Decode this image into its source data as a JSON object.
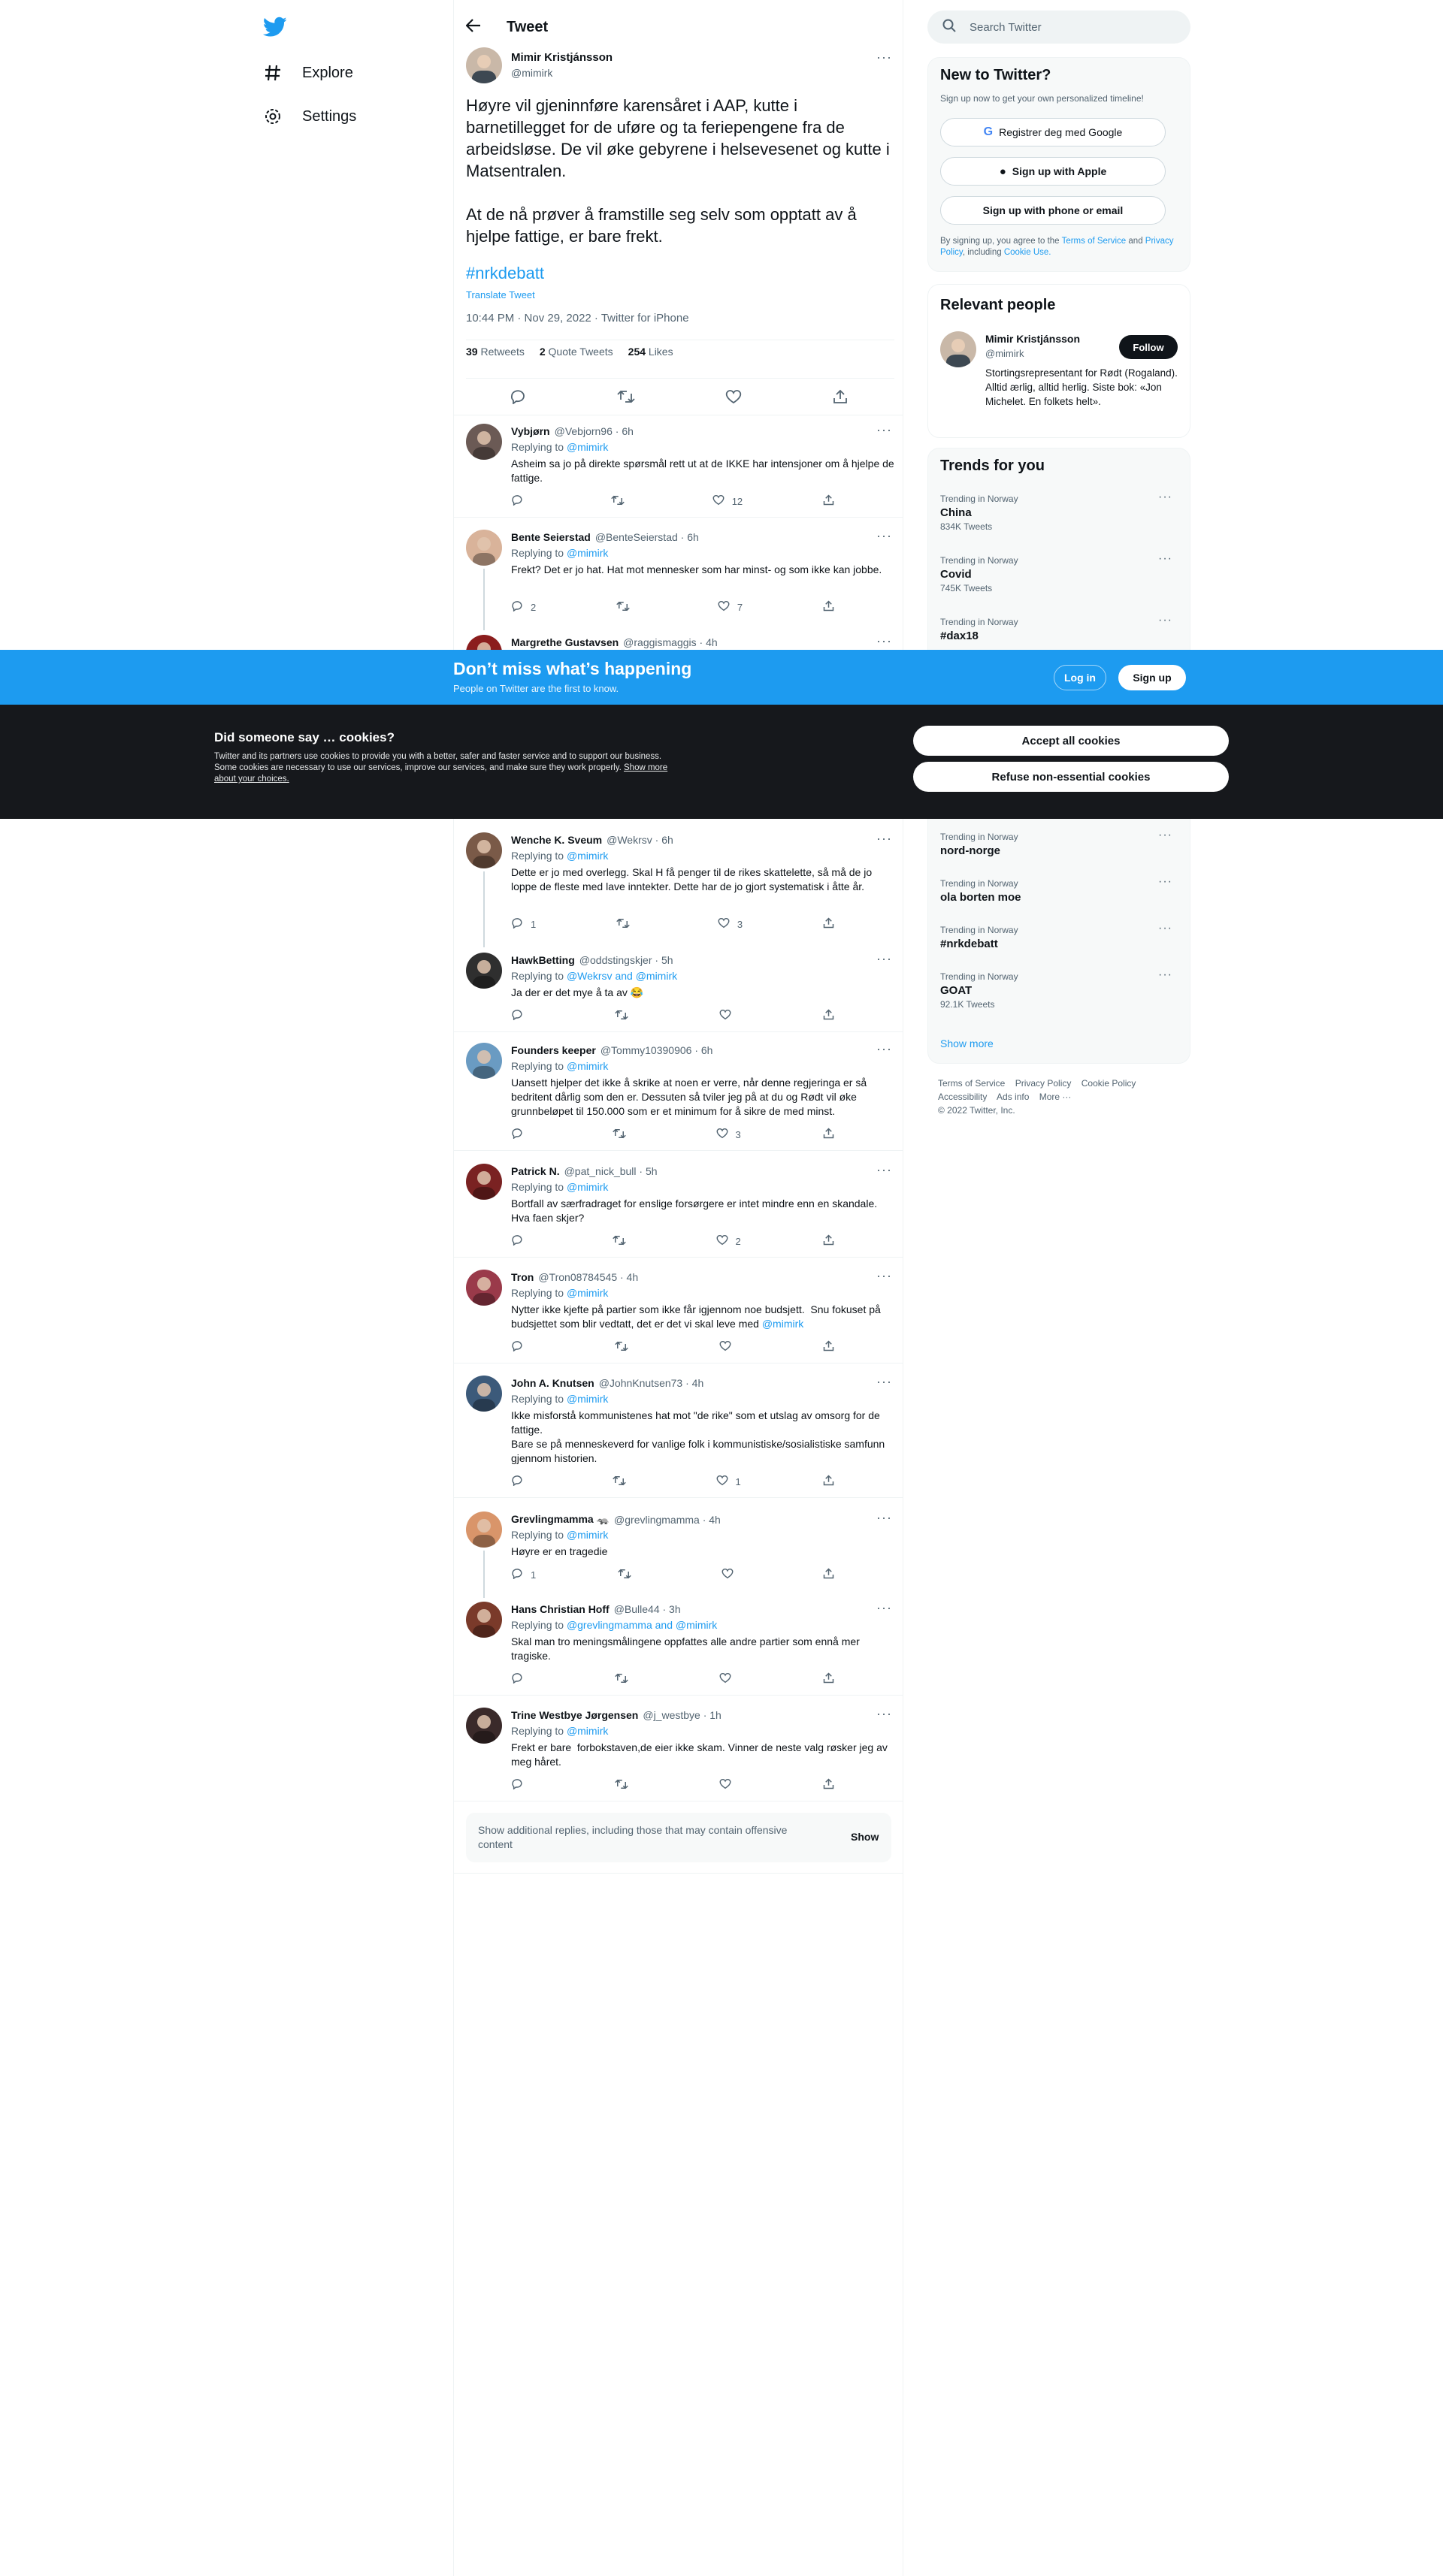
{
  "nav": {
    "items": [
      {
        "label": "Explore",
        "icon": "hashtag-icon"
      },
      {
        "label": "Settings",
        "icon": "gear-icon"
      }
    ]
  },
  "header": {
    "title": "Tweet"
  },
  "tweet": {
    "author_name": "Mimir Kristjánsson",
    "author_handle": "@mimirk",
    "text": "Høyre vil gjeninnføre karensåret i AAP, kutte i barnetillegget for de uføre og ta feriepengene fra de arbeidsløse. De vil øke gebyrene i helsevesenet og kutte i Matsentralen.\n\nAt de nå prøver å framstille seg selv som opptatt av å hjelpe fattige, er bare frekt.",
    "hashtag": "#nrkdebatt",
    "translate": "Translate Tweet",
    "meta": "10:44 PM · Nov 29, 2022 · Twitter for iPhone",
    "retweets": "39",
    "retweets_label": "Retweets",
    "quotes": "2",
    "quotes_label": "Quote Tweets",
    "likes": "254",
    "likes_label": "Likes"
  },
  "replies": [
    {
      "name": "Vybjørn",
      "handle": "@Vebjorn96 · 6h",
      "replying_label": "Replying to",
      "replying_to": "@mimirk",
      "text": "Asheim sa jo på direkte spørsmål rett ut at de IKKE har intensjoner om å hjelpe de fattige.",
      "replies": "",
      "retweets": "",
      "likes": "12"
    },
    {
      "name": "Bente Seierstad",
      "handle": "@BenteSeierstad · 6h",
      "replying_label": "Replying to",
      "replying_to": "@mimirk",
      "text": "Frekt? Det er jo hat. Hat mot mennesker som har minst- og som ikke kan jobbe.",
      "replies": "2",
      "retweets": "",
      "likes": "7"
    },
    {
      "name": "Margrethe Gustavsen",
      "handle": "@raggismaggis · 4h"
    },
    {
      "name": "Wenche K. Sveum",
      "handle": "@Wekrsv · 6h",
      "replying_label": "Replying to",
      "replying_to": "@mimirk",
      "text": "Dette er jo med overlegg. Skal H få penger til de rikes skattelette, så må de jo loppe de fleste med lave inntekter. Dette har de jo gjort systematisk i åtte år.",
      "replies": "1",
      "retweets": "",
      "likes": "3"
    },
    {
      "name": "HawkBetting",
      "handle": "@oddstingskjer · 5h",
      "replying_label": "Replying to",
      "replying_to": "@Wekrsv and @mimirk",
      "text": "Ja der er det mye å ta av 😂",
      "replies": "",
      "retweets": "",
      "likes": ""
    },
    {
      "name": "Founders keeper",
      "handle": "@Tommy10390906 · 6h",
      "replying_label": "Replying to",
      "replying_to": "@mimirk",
      "text": "Uansett hjelper det ikke å skrike at noen er verre, når denne regjeringa er så bedritent dårlig som den er. Dessuten så tviler jeg på at du og Rødt vil øke grunnbeløpet til 150.000 som er et minimum for å sikre de med minst.",
      "replies": "",
      "retweets": "",
      "likes": "3"
    },
    {
      "name": "Patrick N.",
      "handle": "@pat_nick_bull · 5h",
      "replying_label": "Replying to",
      "replying_to": "@mimirk",
      "text": "Bortfall av særfradraget for enslige forsørgere er intet mindre enn en skandale. Hva faen skjer?",
      "replies": "",
      "retweets": "",
      "likes": "2"
    },
    {
      "name": "Tron",
      "handle": "@Tron08784545 · 4h",
      "replying_label": "Replying to",
      "replying_to": "@mimirk",
      "text": "Nytter ikke kjefte på partier som ikke får igjennom noe budsjett.  Snu fokuset på budsjettet som blir vedtatt, det er det vi skal leve med",
      "text_link": "@mimirk",
      "replies": "",
      "retweets": "",
      "likes": ""
    },
    {
      "name": "John A. Knutsen",
      "handle": "@JohnKnutsen73 · 4h",
      "replying_label": "Replying to",
      "replying_to": "@mimirk",
      "text": "Ikke misforstå kommunistenes hat mot \"de rike\" som et utslag av omsorg for de fattige.\nBare se på menneskeverd for vanlige folk i kommunistiske/sosialistiske samfunn gjennom historien.",
      "replies": "",
      "retweets": "",
      "likes": "1"
    },
    {
      "name": "Grevlingmamma 🦡",
      "handle": "@grevlingmamma · 4h",
      "replying_label": "Replying to",
      "replying_to": "@mimirk",
      "text": "Høyre er en tragedie",
      "replies": "1",
      "retweets": "",
      "likes": ""
    },
    {
      "name": "Hans Christian Hoff",
      "handle": "@Bulle44 · 3h",
      "replying_label": "Replying to",
      "replying_to": "@grevlingmamma and @mimirk",
      "text": "Skal man tro meningsmålingene oppfattes alle andre partier som ennå mer tragiske.",
      "replies": "",
      "retweets": "",
      "likes": ""
    },
    {
      "name": "Trine Westbye Jørgensen",
      "handle": "@j_westbye · 1h",
      "replying_label": "Replying to",
      "replying_to": "@mimirk",
      "text": "Frekt er bare  forbokstaven,de eier ikke skam. Vinner de neste valg røsker jeg av meg håret.",
      "replies": "",
      "retweets": "",
      "likes": ""
    }
  ],
  "show_more": {
    "text": "Show additional replies, including those that may contain offensive content",
    "button": "Show"
  },
  "search": {
    "placeholder": "Search Twitter"
  },
  "new_to_twitter": {
    "title": "New to Twitter?",
    "subtitle": "Sign up now to get your own personalized timeline!",
    "google": "Registrer deg med Google",
    "apple": "Sign up with Apple",
    "phone": "Sign up with phone or email",
    "legal_1": "By signing up, you agree to the",
    "terms": "Terms of Service",
    "legal_2": "and",
    "privacy": "Privacy Policy",
    "legal_3": ", including",
    "cookie": "Cookie Use."
  },
  "relevant": {
    "title": "Relevant people",
    "name": "Mimir Kristjánsson",
    "handle": "@mimirk",
    "follow": "Follow",
    "bio": "Stortingsrepresentant for Rødt (Rogaland). Alltid ærlig, alltid herlig. Siste bok: «Jon Michelet. En folkets helt»."
  },
  "trends": {
    "title": "Trends for you",
    "items_top": [
      {
        "context": "Trending in Norway",
        "name": "China",
        "count": "834K Tweets"
      },
      {
        "context": "Trending in Norway",
        "name": "Covid",
        "count": "745K Tweets"
      },
      {
        "context": "Trending in Norway",
        "name": "#dax18",
        "count": ""
      }
    ],
    "items_bottom": [
      {
        "context": "Trending in Norway",
        "name": "nord-norge",
        "count": ""
      },
      {
        "context": "Trending in Norway",
        "name": "ola borten moe",
        "count": ""
      },
      {
        "context": "Trending in Norway",
        "name": "#nrkdebatt",
        "count": ""
      },
      {
        "context": "Trending in Norway",
        "name": "GOAT",
        "count": "92.1K Tweets"
      }
    ],
    "show_more": "Show more"
  },
  "footer": {
    "links": [
      "Terms of Service",
      "Privacy Policy",
      "Cookie Policy",
      "Accessibility",
      "Ads info",
      "More ···"
    ],
    "copyright": "© 2022 Twitter, Inc."
  },
  "banner": {
    "title": "Don’t miss what’s happening",
    "subtitle": "People on Twitter are the first to know.",
    "login": "Log in",
    "signup": "Sign up"
  },
  "cookies": {
    "title": "Did someone say … cookies?",
    "body": "Twitter and its partners use cookies to provide you with a better, safer and faster service and to support our business. Some cookies are necessary to use our services, improve our services, and make sure they work properly.",
    "link": "Show more about your choices.",
    "accept": "Accept all cookies",
    "refuse": "Refuse non-essential cookies"
  },
  "colors": {
    "accent": "#1d9bf0",
    "dark": "#16181c",
    "text": "#0f1419",
    "muted": "#536471"
  }
}
